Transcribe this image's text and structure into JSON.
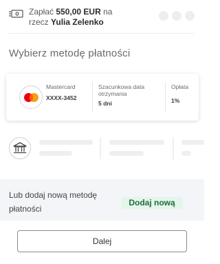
{
  "header": {
    "pay_prefix": "Zapłać ",
    "amount": "550,00 EUR",
    "pay_mid": " na",
    "recipient_prefix": "rzecz ",
    "recipient": "Yulia Zelenko"
  },
  "section_title": "Wybierz metodę płatności",
  "card": {
    "brand": "Mastercard",
    "number": "XXXX-3452",
    "eta_label": "Szacunkowa data otrzymania",
    "eta_value": "5 dni",
    "fee_label": "Opłata",
    "fee_value": "1%"
  },
  "add_section": {
    "text": "Lub dodaj nową metodę płatności",
    "button_label": "Dodaj nową"
  },
  "footer": {
    "next_label": "Dalej"
  },
  "icons": {
    "bill": "banknote-icon",
    "bank": "bank-icon",
    "card": "mastercard-logo"
  },
  "colors": {
    "add_button_bg": "#e4f6ea",
    "add_button_text": "#1f6b3b",
    "mastercard_red": "#eb001b",
    "mastercard_yellow": "#f79e1b"
  }
}
